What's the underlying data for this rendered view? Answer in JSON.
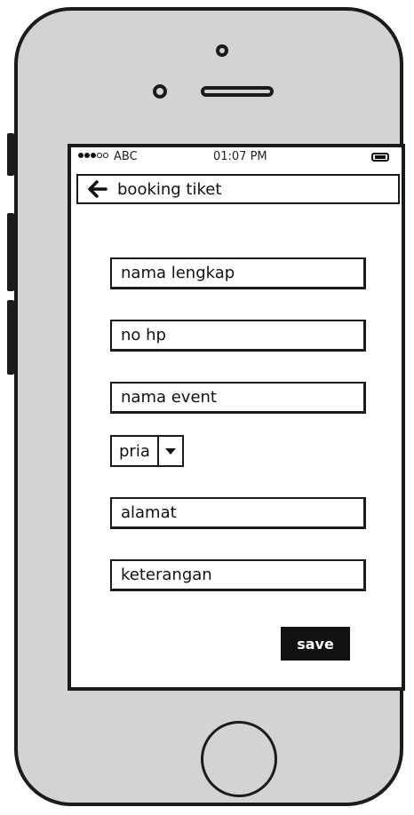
{
  "status_bar": {
    "carrier": "ABC",
    "time": "01:07 PM"
  },
  "header": {
    "title": "booking tiket"
  },
  "form": {
    "nama_lengkap": "nama lengkap",
    "no_hp": "no hp",
    "nama_event": "nama event",
    "gender_selected": "pria",
    "alamat": "alamat",
    "keterangan": "keterangan"
  },
  "actions": {
    "save_label": "save"
  },
  "icons": {
    "back": "arrow-left-icon",
    "dropdown": "caret-down-icon",
    "battery": "battery-icon",
    "signal": "signal-icon"
  },
  "colors": {
    "phone_body": "#d3d3d3",
    "outline": "#1b1b1b",
    "screen": "#ffffff",
    "save_button": "#111111"
  }
}
